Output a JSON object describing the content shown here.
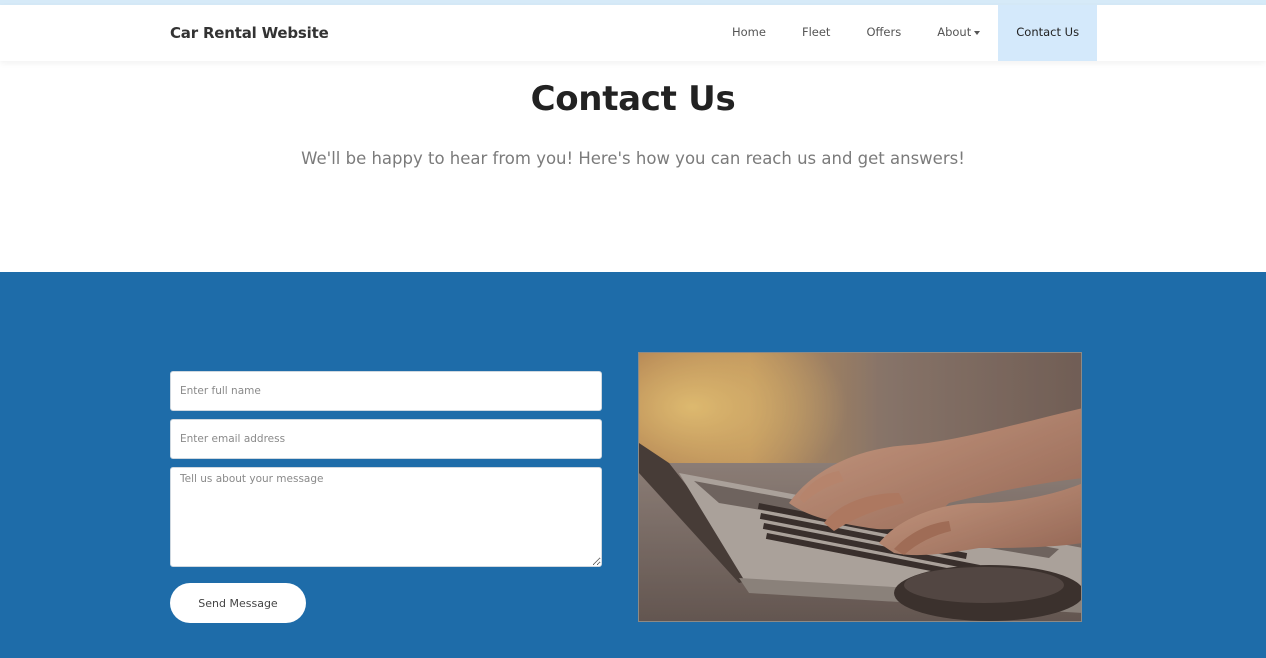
{
  "header": {
    "brand": "Car Rental Website",
    "nav": [
      {
        "label": "Home"
      },
      {
        "label": "Fleet"
      },
      {
        "label": "Offers"
      },
      {
        "label": "About"
      },
      {
        "label": "Contact Us"
      }
    ],
    "active_nav": "Contact Us"
  },
  "hero": {
    "title": "Contact Us",
    "subtitle": "We'll be happy to hear from you! Here's how you can reach us and get answers!"
  },
  "form": {
    "name_placeholder": "Enter full name",
    "email_placeholder": "Enter email address",
    "message_placeholder": "Tell us about your message",
    "submit_label": "Send Message"
  },
  "image": {
    "subject": "hands typing on laptop keyboard"
  },
  "colors": {
    "accent": "#1e6ca9",
    "nav_active_bg": "#d4e9fb",
    "top_accent": "#d6eaf8",
    "title": "#222222",
    "subtitle": "#7b7b7b"
  }
}
